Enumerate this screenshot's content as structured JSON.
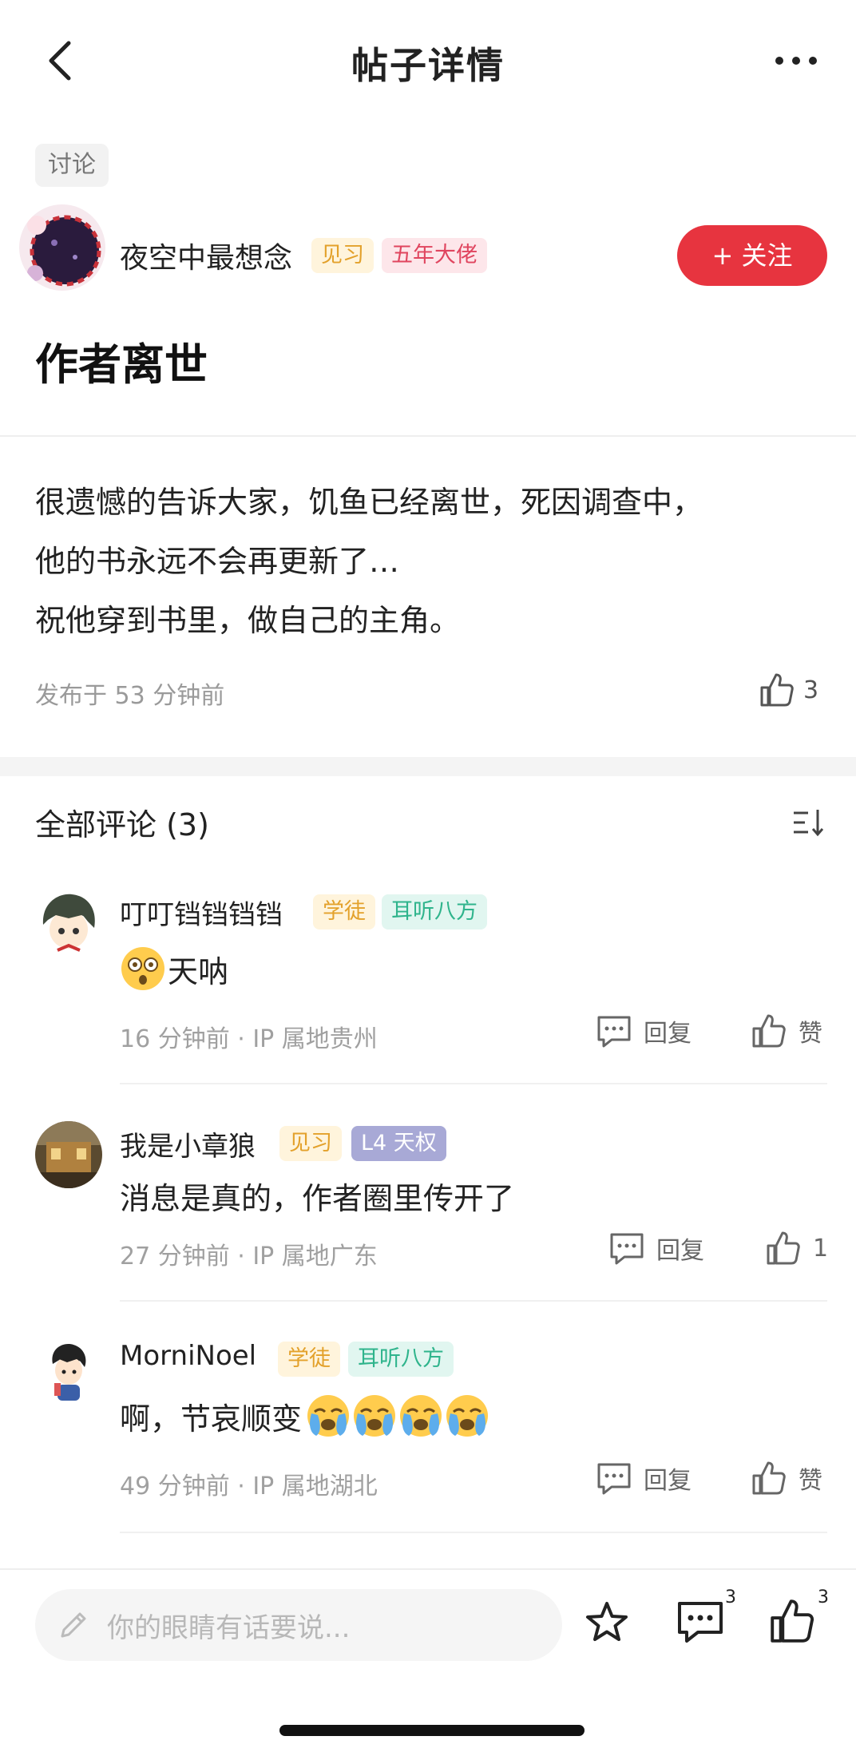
{
  "header": {
    "title": "帖子详情"
  },
  "post": {
    "tag": "讨论",
    "author": {
      "name": "夜空中最想念",
      "badges": [
        "见习",
        "五年大佬"
      ]
    },
    "follow_label": "+ 关注",
    "title": "作者离世",
    "body_lines": [
      "很遗憾的告诉大家，饥鱼已经离世，死因调查中，",
      "他的书永远不会再更新了…",
      "祝他穿到书里，做自己的主角。"
    ],
    "published": "发布于 53 分钟前",
    "like_count": "3"
  },
  "comments_section": {
    "heading": "全部评论 (3)"
  },
  "comments": [
    {
      "name": "叮叮铛铛铛铛",
      "badges": [
        "学徒",
        "耳听八方"
      ],
      "text": "天呐",
      "meta": "16 分钟前 · IP 属地贵州",
      "reply_label": "回复",
      "like_label": "赞"
    },
    {
      "name": "我是小章狼",
      "badges": [
        "见习",
        "L4 天权"
      ],
      "text": "消息是真的，作者圈里传开了",
      "meta": "27 分钟前 · IP 属地广东",
      "reply_label": "回复",
      "like_label": "1"
    },
    {
      "name": "MorniNoel",
      "badges": [
        "学徒",
        "耳听八方"
      ],
      "text": "啊，节哀顺变",
      "meta": "49 分钟前 · IP 属地湖北",
      "reply_label": "回复",
      "like_label": "赞"
    }
  ],
  "bottom_bar": {
    "input_placeholder": "你的眼睛有话要说...",
    "comment_count": "3",
    "like_count": "3"
  },
  "icons": [
    "back-arrow-icon",
    "more-icon",
    "thumbs-up-icon",
    "sort-icon",
    "chat-icon",
    "star-icon",
    "pencil-icon",
    "shocked-emoji",
    "crying-emoji"
  ],
  "colors": {
    "accent": "#e7343f"
  }
}
